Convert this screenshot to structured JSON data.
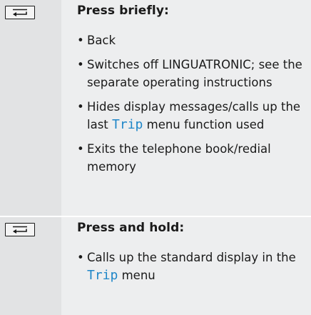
{
  "sections": [
    {
      "heading": "Press briefly:",
      "items": [
        {
          "pre": "Back",
          "term": "",
          "post": ""
        },
        {
          "pre": "Switches off LINGUATRONIC; see the separate operating instructions",
          "term": "",
          "post": ""
        },
        {
          "pre": "Hides display messages/calls up the last ",
          "term": "Trip",
          "post": " menu function used"
        },
        {
          "pre": "Exits the telephone book/redial memory",
          "term": "",
          "post": ""
        }
      ]
    },
    {
      "heading": "Press and hold:",
      "items": [
        {
          "pre": "Calls up the standard display in the ",
          "term": "Trip",
          "post": " menu"
        }
      ]
    }
  ],
  "key_icon": "back-arrow-icon",
  "colors": {
    "term": "#1f86c8",
    "row_bg": "#edeeef",
    "key_col_bg": "#e2e3e4"
  }
}
